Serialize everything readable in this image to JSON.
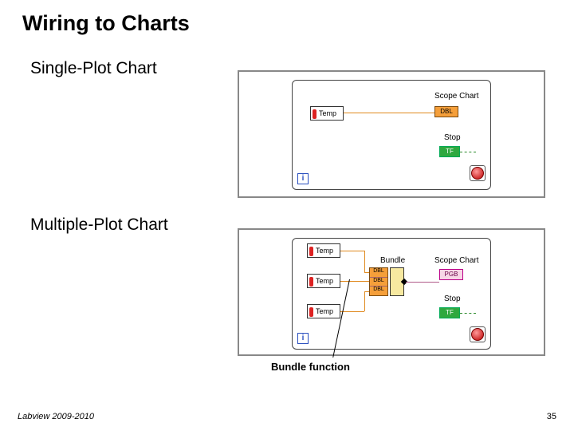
{
  "title": "Wiring to Charts",
  "section1": "Single-Plot Chart",
  "section2": "Multiple-Plot Chart",
  "caption": "Bundle function",
  "footer": {
    "left": "Labview 2009-2010",
    "page": "35"
  },
  "diagram": {
    "iter": "i",
    "temp": "Temp",
    "scope": "Scope Chart",
    "stop": "Stop",
    "bundle": "Bundle",
    "dbl": "DBL",
    "tf": "TF",
    "pgb": "PGB"
  }
}
